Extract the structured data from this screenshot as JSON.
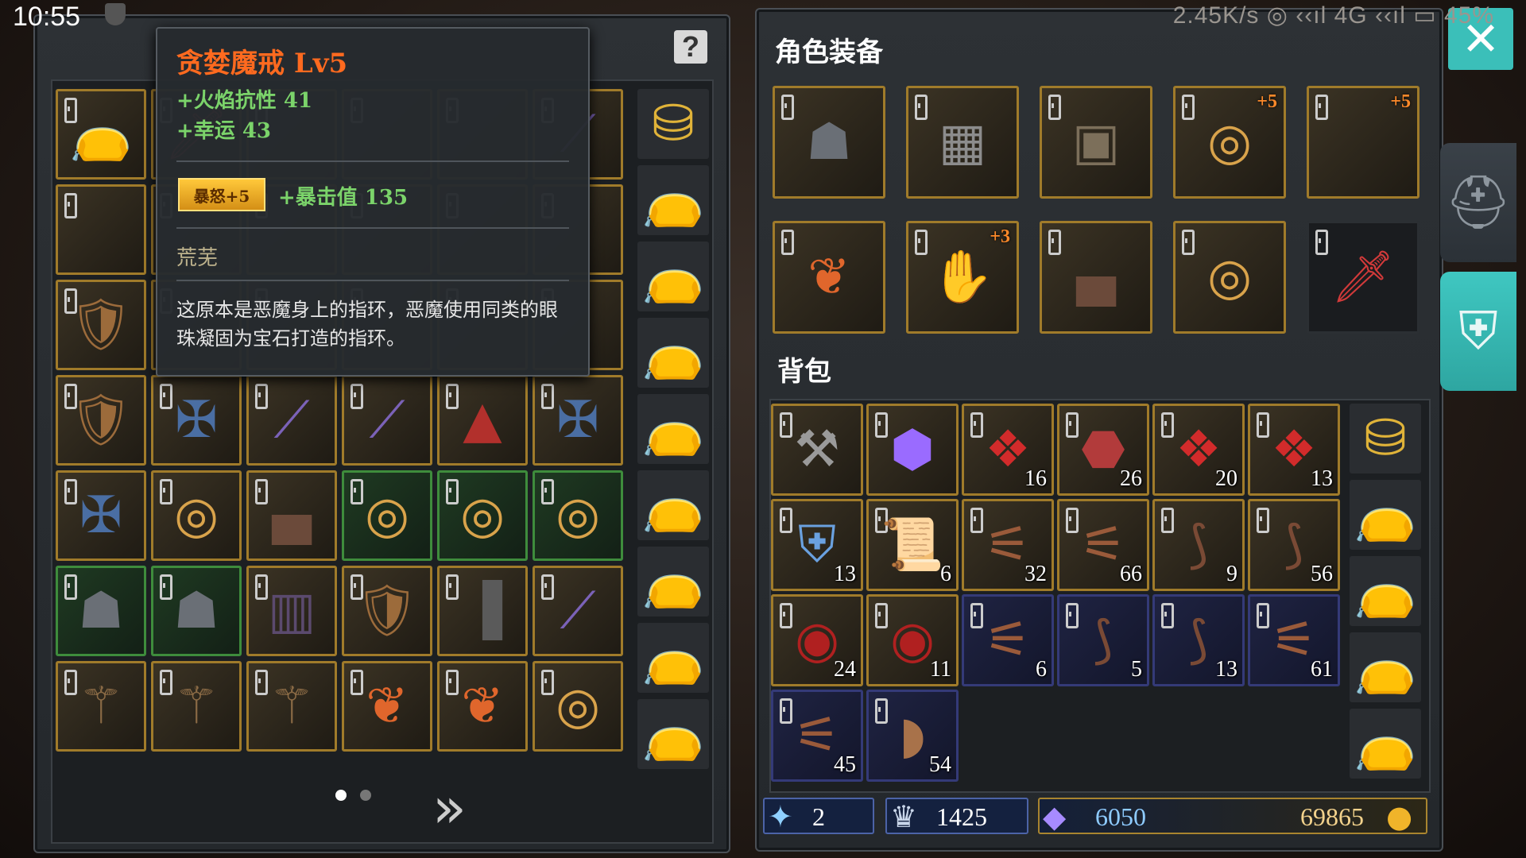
{
  "status_bar": {
    "time": "10:55",
    "network": "2.45K/s ◎ ‹‹ıl 4G ‹‹ıl ▭ 45%"
  },
  "tooltip": {
    "item_name": "贪婪魔戒 Lv5",
    "stat1": "+火焰抗性 41",
    "stat2": "+幸运 43",
    "enchant_badge": "暴怒+5",
    "enchant_stat": "+暴击值 135",
    "set_name": "荒芜",
    "description": "这原本是恶魔身上的指环，恶魔使用同类的眼珠凝固为宝石打造的指环。"
  },
  "help_button": "?",
  "left_inventory": {
    "grid": [
      [
        "bag",
        "sword",
        "",
        "",
        "",
        "spear"
      ],
      [
        "",
        "",
        "",
        "",
        "",
        ""
      ],
      [
        "armor",
        "",
        "",
        "",
        "",
        ""
      ],
      [
        "armor",
        "crossbow",
        "spear",
        "spear",
        "cloak",
        "crossbow"
      ],
      [
        "crossbow",
        "ring",
        "boots",
        "ring",
        "ring",
        "ring"
      ],
      [
        "helmet",
        "helmet",
        "pants",
        "armor",
        "greaves",
        "spear"
      ],
      [
        "staff",
        "staff",
        "staff",
        "amulet",
        "amulet",
        "ring"
      ]
    ],
    "side_column": [
      "backpack",
      "bag",
      "bag",
      "bag",
      "bag",
      "bag",
      "bag",
      "bag",
      "bag"
    ],
    "page_dots": [
      true,
      false
    ],
    "next_label": "»"
  },
  "equipment": {
    "heading": "角色装备",
    "slots": [
      {
        "icon": "helmet",
        "plus": "",
        "rarity": "gold"
      },
      {
        "icon": "shoulder",
        "plus": "",
        "rarity": "gold"
      },
      {
        "icon": "chest",
        "plus": "",
        "rarity": "gold"
      },
      {
        "icon": "ring",
        "plus": "+5",
        "rarity": "gold"
      },
      {
        "icon": "",
        "plus": "+5",
        "rarity": "gold"
      },
      {
        "icon": "amulet",
        "plus": "",
        "rarity": "gold"
      },
      {
        "icon": "gloves",
        "plus": "+3",
        "rarity": "gold"
      },
      {
        "icon": "boots",
        "plus": "",
        "rarity": "gold"
      },
      {
        "icon": "ring",
        "plus": "",
        "rarity": "gold"
      },
      {
        "icon": "sword",
        "plus": "",
        "rarity": "dark"
      }
    ]
  },
  "backpack": {
    "heading": "背包",
    "items": [
      {
        "icon": "axe",
        "count": "",
        "rarity": "gold"
      },
      {
        "icon": "gem",
        "count": "",
        "rarity": "gold"
      },
      {
        "icon": "crystal",
        "count": "16",
        "rarity": "gold"
      },
      {
        "icon": "ore",
        "count": "26",
        "rarity": "gold"
      },
      {
        "icon": "crystal",
        "count": "20",
        "rarity": "gold"
      },
      {
        "icon": "crystal",
        "count": "13",
        "rarity": "gold"
      },
      {
        "icon": "shield",
        "count": "13",
        "rarity": "gold"
      },
      {
        "icon": "scroll",
        "count": "6",
        "rarity": "gold"
      },
      {
        "icon": "claw",
        "count": "32",
        "rarity": "gold"
      },
      {
        "icon": "claw",
        "count": "66",
        "rarity": "gold"
      },
      {
        "icon": "horn",
        "count": "9",
        "rarity": "gold"
      },
      {
        "icon": "horn",
        "count": "56",
        "rarity": "gold"
      },
      {
        "icon": "orb",
        "count": "24",
        "rarity": "gold"
      },
      {
        "icon": "orb",
        "count": "11",
        "rarity": "gold"
      },
      {
        "icon": "claw",
        "count": "6",
        "rarity": "blue"
      },
      {
        "icon": "horn",
        "count": "5",
        "rarity": "blue"
      },
      {
        "icon": "horn",
        "count": "13",
        "rarity": "blue"
      },
      {
        "icon": "claw",
        "count": "61",
        "rarity": "blue"
      },
      {
        "icon": "claw",
        "count": "45",
        "rarity": "blue"
      },
      {
        "icon": "shell",
        "count": "54",
        "rarity": "blue"
      }
    ],
    "side_column": [
      "backpack",
      "bag",
      "bag",
      "bag",
      "bag"
    ]
  },
  "currency": {
    "wand": "2",
    "crown": "1425",
    "crystal": "6050",
    "gold": "69865"
  },
  "close_label": "✕"
}
